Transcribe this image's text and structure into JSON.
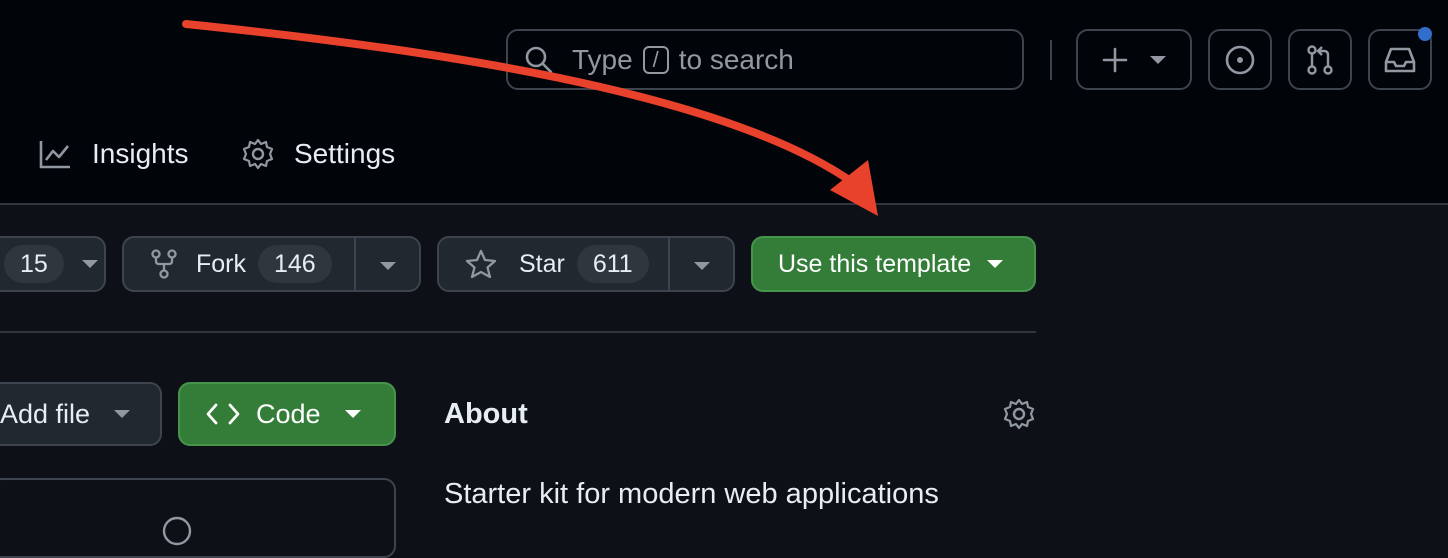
{
  "header": {
    "search": {
      "prefix": "Type",
      "key": "/",
      "suffix": "to search"
    },
    "buttons": {
      "create_icon": "plus-icon",
      "issues_icon": "issue-opened-icon",
      "pulls_icon": "git-pull-request-icon",
      "inbox_icon": "inbox-icon"
    },
    "notification_dot_color": "#316dca"
  },
  "nav": {
    "insights": "Insights",
    "settings": "Settings"
  },
  "repo_actions": {
    "watch_count": "15",
    "fork_label": "Fork",
    "fork_count": "146",
    "star_label": "Star",
    "star_count": "611",
    "template_label": "Use this template"
  },
  "file_actions": {
    "add_file": "Add file",
    "code": "Code"
  },
  "about": {
    "title": "About",
    "description": "Starter kit for modern web applications"
  },
  "colors": {
    "accent_green": "#347d39",
    "annotation_arrow": "#e8412c"
  }
}
